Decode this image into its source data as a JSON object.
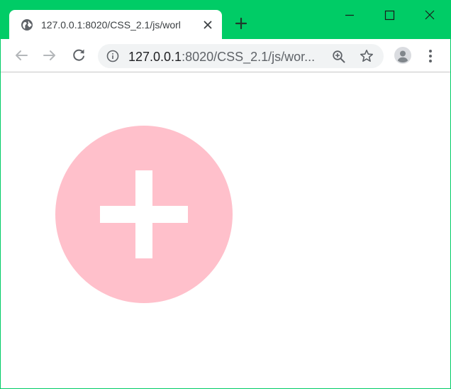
{
  "window": {
    "frame_color": "#00cc66"
  },
  "tab": {
    "title": "127.0.0.1:8020/CSS_2.1/js/worl",
    "favicon": "globe-icon",
    "close_icon": "close-icon"
  },
  "titlebar": {
    "new_tab_icon": "plus-icon",
    "minimize_icon": "minimize-icon",
    "maximize_icon": "maximize-icon",
    "close_icon": "close-icon"
  },
  "toolbar": {
    "back_icon": "back-arrow-icon",
    "forward_icon": "forward-arrow-icon",
    "reload_icon": "reload-icon",
    "address": {
      "info_icon": "info-icon",
      "host": "127.0.0.1",
      "rest": ":8020/CSS_2.1/js/wor...",
      "zoom_icon": "zoom-in-icon",
      "bookmark_icon": "star-icon"
    },
    "profile_icon": "avatar-icon",
    "menu_icon": "more-vert-icon"
  },
  "page": {
    "button": {
      "color": "#ffc0cb",
      "icon": "plus-icon",
      "icon_color": "#ffffff"
    }
  }
}
